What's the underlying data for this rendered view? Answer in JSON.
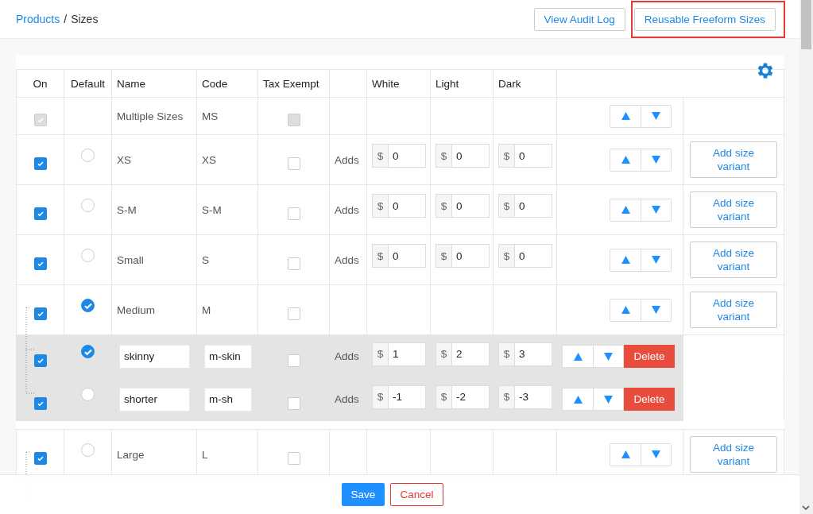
{
  "breadcrumb": {
    "link": "Products",
    "separator": "/",
    "current": "Sizes"
  },
  "header_buttons": [
    {
      "label": "View Audit Log",
      "highlighted": false
    },
    {
      "label": "Reusable Freeform Sizes",
      "highlighted": true
    }
  ],
  "table": {
    "columns": [
      "On",
      "Default",
      "Name",
      "Code",
      "Tax Exempt",
      "White",
      "Light",
      "Dark"
    ],
    "rows": [
      {
        "kind": "group",
        "on": true,
        "disabled": true,
        "name": "Multiple Sizes",
        "code": "MS",
        "tax_exempt": false
      },
      {
        "kind": "size",
        "on": true,
        "disabled": false,
        "default": false,
        "name": "XS",
        "code": "XS",
        "tax_exempt": false,
        "adds": "Adds",
        "prices": [
          {
            "currency": "$",
            "value": "0"
          },
          {
            "currency": "$",
            "value": "0"
          },
          {
            "currency": "$",
            "value": "0"
          }
        ],
        "action": "Add size variant"
      },
      {
        "kind": "size",
        "on": true,
        "disabled": false,
        "default": false,
        "name": "S-M",
        "code": "S-M",
        "tax_exempt": false,
        "adds": "Adds",
        "prices": [
          {
            "currency": "$",
            "value": "0"
          },
          {
            "currency": "$",
            "value": "0"
          },
          {
            "currency": "$",
            "value": "0"
          }
        ],
        "action": "Add size variant"
      },
      {
        "kind": "size",
        "on": true,
        "disabled": false,
        "default": false,
        "name": "Small",
        "code": "S",
        "tax_exempt": false,
        "adds": "Adds",
        "prices": [
          {
            "currency": "$",
            "value": "0"
          },
          {
            "currency": "$",
            "value": "0"
          },
          {
            "currency": "$",
            "value": "0"
          }
        ],
        "action": "Add size variant"
      },
      {
        "kind": "parent",
        "on": true,
        "disabled": false,
        "default": true,
        "name": "Medium",
        "code": "M",
        "tax_exempt": false,
        "action": "Add size variant",
        "children": [
          {
            "kind": "variant",
            "on": true,
            "disabled": false,
            "default": true,
            "name": "skinny",
            "code": "m-skin",
            "tax_exempt": false,
            "adds": "Adds",
            "prices": [
              {
                "currency": "$",
                "value": "1"
              },
              {
                "currency": "$",
                "value": "2"
              },
              {
                "currency": "$",
                "value": "3"
              }
            ],
            "action": "Delete"
          },
          {
            "kind": "variant",
            "on": true,
            "disabled": false,
            "default": false,
            "name": "shorter",
            "code": "m-sh",
            "tax_exempt": false,
            "adds": "Adds",
            "prices": [
              {
                "currency": "$",
                "value": "-1"
              },
              {
                "currency": "$",
                "value": "-2"
              },
              {
                "currency": "$",
                "value": "-3"
              }
            ],
            "action": "Delete"
          }
        ]
      },
      {
        "kind": "parent",
        "on": true,
        "disabled": false,
        "default": false,
        "name": "Large",
        "code": "L",
        "tax_exempt": false,
        "action": "Add size variant"
      }
    ]
  },
  "footer": {
    "save": "Save",
    "cancel": "Cancel"
  }
}
